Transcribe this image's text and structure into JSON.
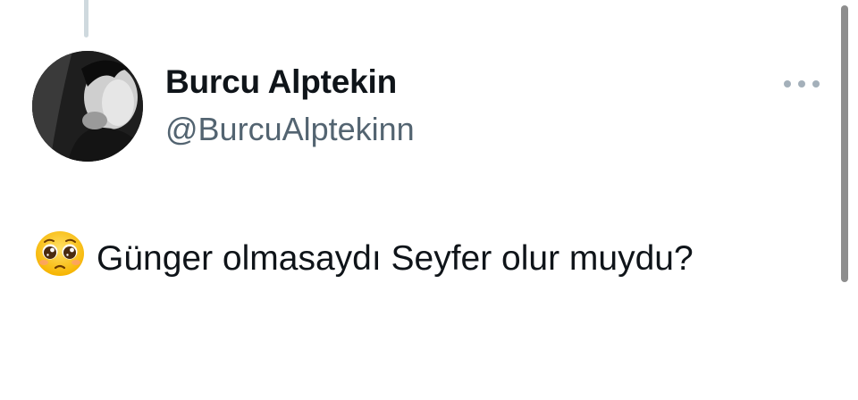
{
  "tweet": {
    "author": {
      "display_name": "Burcu Alptekin",
      "handle": "@BurcuAlptekinn",
      "avatar_icon": "profile-photo"
    },
    "more_icon": "more-options-icon",
    "emoji_icon": "pleading-face-emoji",
    "text": "Günger olmasaydı Seyfer olur muydu?"
  },
  "colors": {
    "text_primary": "#0f1419",
    "text_secondary": "#536471",
    "thread_line": "#cfd9de",
    "scrollbar": "#8e8e8e"
  }
}
